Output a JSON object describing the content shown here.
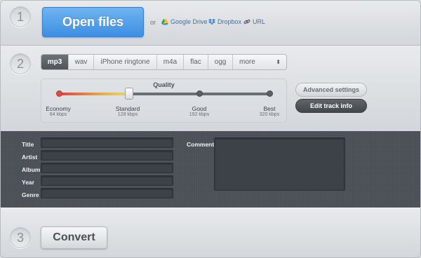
{
  "step1": {
    "number": "1",
    "open_button": "Open files",
    "or": "or",
    "sources": [
      {
        "label": "Google Drive",
        "icon": "google-drive-icon"
      },
      {
        "label": "Dropbox",
        "icon": "dropbox-icon"
      },
      {
        "label": "URL",
        "icon": "link-icon"
      }
    ]
  },
  "step2": {
    "number": "2",
    "formats": [
      {
        "label": "mp3",
        "active": true
      },
      {
        "label": "wav"
      },
      {
        "label": "iPhone ringtone"
      },
      {
        "label": "m4a"
      },
      {
        "label": "flac"
      },
      {
        "label": "ogg"
      },
      {
        "label": "more",
        "icon": "up-down-arrows-icon"
      }
    ],
    "quality": {
      "title": "Quality",
      "selected_index": 1,
      "levels": [
        {
          "label": "Economy",
          "sub": "64 kbps"
        },
        {
          "label": "Standard",
          "sub": "128 kbps"
        },
        {
          "label": "Good",
          "sub": "192 kbps"
        },
        {
          "label": "Best",
          "sub": "320 kbps"
        }
      ]
    },
    "advanced_button": "Advanced settings",
    "edit_button": "Edit track info"
  },
  "metadata": {
    "fields": [
      {
        "label": "Title",
        "value": ""
      },
      {
        "label": "Artist",
        "value": ""
      },
      {
        "label": "Album",
        "value": ""
      },
      {
        "label": "Year",
        "value": ""
      },
      {
        "label": "Genre",
        "value": ""
      }
    ],
    "comment_label": "Comment",
    "comment_value": ""
  },
  "step3": {
    "number": "3",
    "convert_button": "Convert"
  },
  "colors": {
    "accent_blue": "#3d8ee3",
    "link_blue": "#3a6fb4",
    "panel_dark": "#4b5057",
    "track_red": "#e0413a",
    "track_yellow": "#e8d86a"
  }
}
